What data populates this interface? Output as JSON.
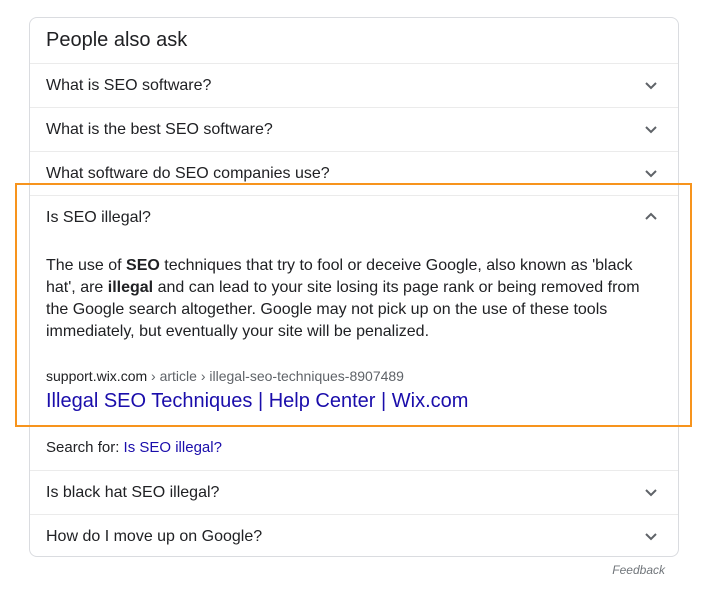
{
  "panel": {
    "title": "People also ask",
    "questions_top": [
      {
        "text": "What is SEO software?",
        "state": "collapsed"
      },
      {
        "text": "What is the best SEO software?",
        "state": "collapsed"
      },
      {
        "text": "What software do SEO companies use?",
        "state": "collapsed"
      }
    ],
    "expanded": {
      "question": "Is SEO illegal?",
      "answer": {
        "t1": "The use of ",
        "b1": "SEO",
        "t2": " techniques that try to fool or deceive Google, also known as 'black hat', are ",
        "b2": "illegal",
        "t3": " and can lead to your site losing its page rank or being removed from the Google search altogether. Google may not pick up on the use of these tools immediately, but eventually your site will be penalized."
      },
      "source_domain": "support.wix.com",
      "source_path": " › article › illegal-seo-techniques-8907489",
      "link_title": "Illegal SEO Techniques | Help Center | Wix.com",
      "search_for_label": "Search for: ",
      "search_for_query": "Is SEO illegal?"
    },
    "questions_bottom": [
      {
        "text": "Is black hat SEO illegal?",
        "state": "collapsed"
      },
      {
        "text": "How do I move up on Google?",
        "state": "collapsed"
      }
    ],
    "feedback": "Feedback"
  },
  "colors": {
    "link": "#1a0dab",
    "highlight_border": "#f7941d",
    "divider": "#ebebeb"
  }
}
